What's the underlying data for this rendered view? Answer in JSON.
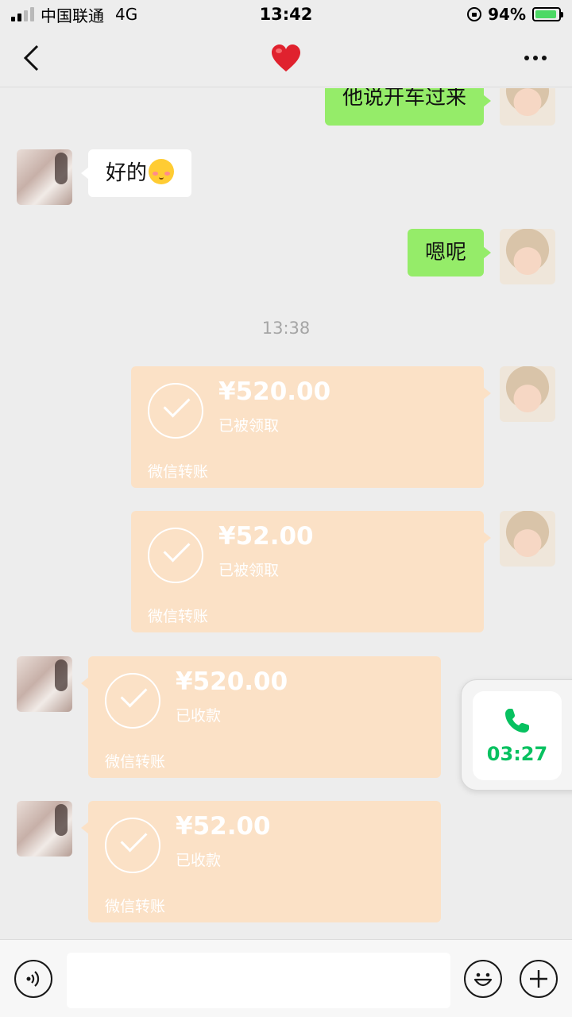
{
  "status_bar": {
    "carrier": "中国联通",
    "network": "4G",
    "time": "13:42",
    "battery_percent": "94%",
    "battery_level": 0.94,
    "icons": [
      "signal-icon",
      "rotation-lock-icon",
      "battery-charging-icon"
    ]
  },
  "nav": {
    "title_icon": "heart-icon",
    "back_icon": "chevron-left-icon",
    "more_icon": "more-dots-icon"
  },
  "messages": {
    "m1_text": "他说开车过来",
    "m2_text": "好的",
    "m2_emoji": "blushing-face-icon",
    "m3_text": "嗯呢",
    "time_separator": "13:38"
  },
  "transfers": [
    {
      "amount": "¥520.00",
      "status": "已被领取",
      "label": "微信转账",
      "side": "right"
    },
    {
      "amount": "¥52.00",
      "status": "已被领取",
      "label": "微信转账",
      "side": "right"
    },
    {
      "amount": "¥520.00",
      "status": "已收款",
      "label": "微信转账",
      "side": "left"
    },
    {
      "amount": "¥52.00",
      "status": "已收款",
      "label": "微信转账",
      "side": "left"
    }
  ],
  "call_widget": {
    "duration": "03:27",
    "icon": "phone-icon"
  },
  "input_bar": {
    "voice_icon": "voice-icon",
    "emoji_icon": "emoji-icon",
    "plus_icon": "plus-icon",
    "value": ""
  },
  "colors": {
    "my_bubble": "#95ec69",
    "their_bubble": "#ffffff",
    "transfer_card": "#fbe1c6",
    "call_green": "#07c160",
    "background": "#ededed"
  }
}
